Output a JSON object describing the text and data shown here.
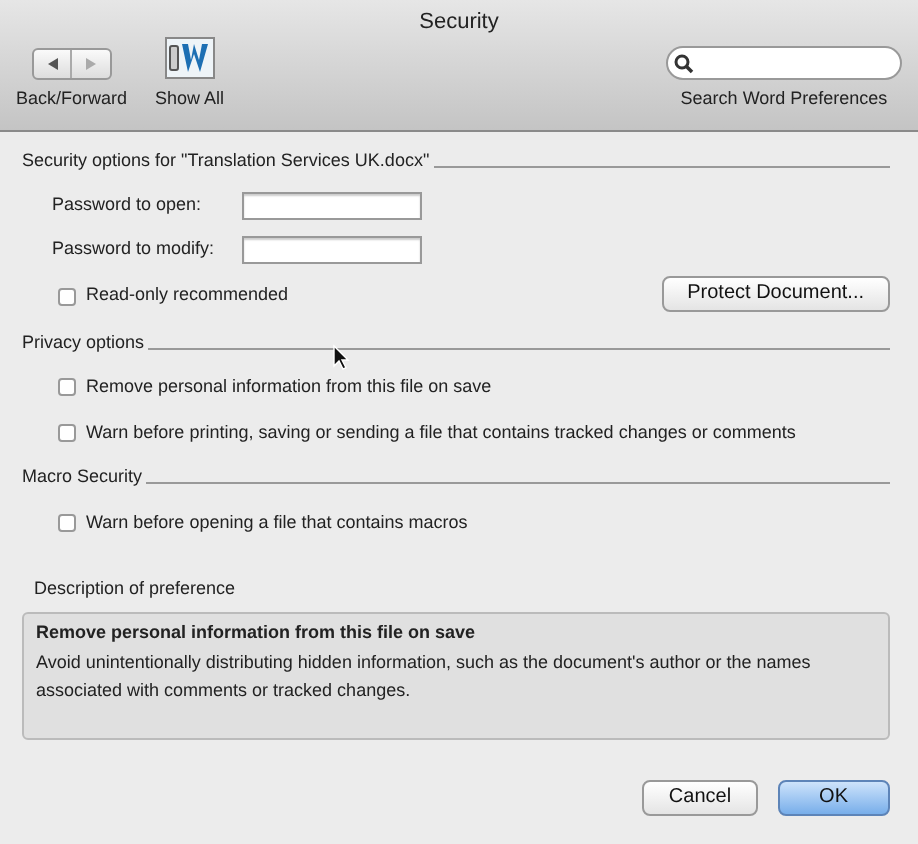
{
  "window": {
    "title": "Security"
  },
  "toolbar": {
    "back_forward": "Back/Forward",
    "show_all": "Show All",
    "search": {
      "label": "Search Word Preferences"
    }
  },
  "security_options": {
    "heading": "Security options for \"Translation Services UK.docx\"",
    "fields": [
      {
        "label": "Password to open:"
      },
      {
        "label": "Password to modify:"
      }
    ],
    "read_only": {
      "label": "Read-only recommended",
      "checked": false
    },
    "protect_button": "Protect Document..."
  },
  "privacy_options": {
    "heading": "Privacy options",
    "options": [
      {
        "label": "Remove personal information from this file on save",
        "checked": false
      },
      {
        "label": "Warn before printing, saving or sending a file that contains tracked changes or comments",
        "checked": false
      }
    ]
  },
  "macro_security": {
    "heading": "Macro Security",
    "options": [
      {
        "label": "Warn before opening a file that contains macros",
        "checked": false
      }
    ]
  },
  "description": {
    "heading": "Description of preference",
    "title": "Remove personal information from this file on save",
    "text": "Avoid unintentionally distributing hidden information, such as the document's author or the names associated with comments or tracked changes."
  },
  "buttons": [
    {
      "label": "Cancel",
      "default": false
    },
    {
      "label": "OK",
      "default": true
    }
  ]
}
